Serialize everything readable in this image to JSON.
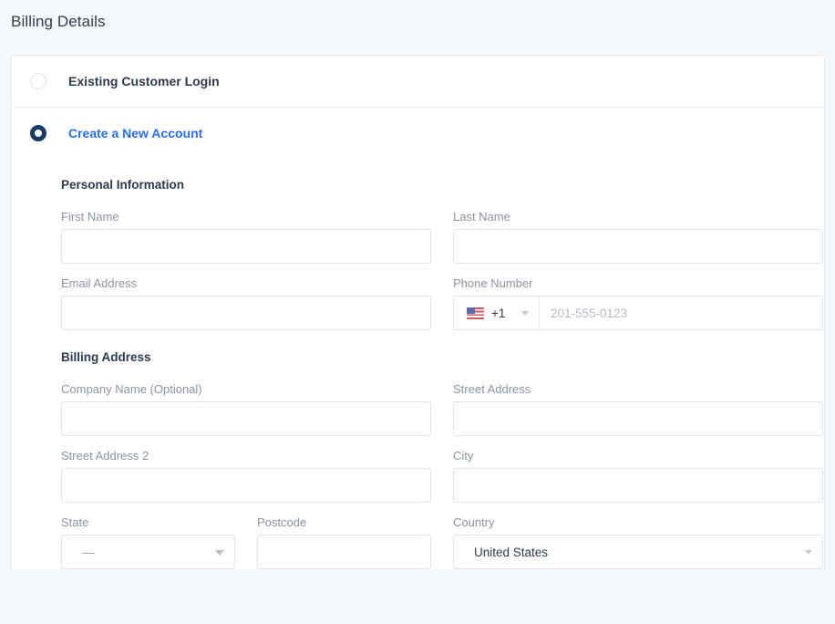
{
  "page": {
    "title": "Billing Details"
  },
  "account_options": [
    {
      "label": "Existing Customer Login",
      "selected": false,
      "name": "existing-customer-login"
    },
    {
      "label": "Create a New Account",
      "selected": true,
      "name": "create-new-account"
    }
  ],
  "sections": {
    "personal": {
      "title": "Personal Information",
      "first_name": {
        "label": "First Name",
        "value": "",
        "placeholder": ""
      },
      "last_name": {
        "label": "Last Name",
        "value": "",
        "placeholder": ""
      },
      "email": {
        "label": "Email Address",
        "value": "",
        "placeholder": ""
      },
      "phone": {
        "label": "Phone Number",
        "country_flag": "us-flag-icon",
        "dial_code": "+1",
        "value": "",
        "placeholder": "201-555-0123"
      }
    },
    "billing": {
      "title": "Billing Address",
      "company": {
        "label": "Company Name (Optional)",
        "value": "",
        "placeholder": ""
      },
      "street": {
        "label": "Street Address",
        "value": "",
        "placeholder": ""
      },
      "street2": {
        "label": "Street Address 2",
        "value": "",
        "placeholder": ""
      },
      "city": {
        "label": "City",
        "value": "",
        "placeholder": ""
      },
      "state": {
        "label": "State",
        "value": "—"
      },
      "postcode": {
        "label": "Postcode",
        "value": "",
        "placeholder": ""
      },
      "country": {
        "label": "Country",
        "value": "United States"
      }
    }
  },
  "icons": {
    "caret_down": "chevron-down-icon"
  },
  "colors": {
    "page_background": "#f4f8fb",
    "card_background": "#ffffff",
    "link_accent": "#2a6ee0",
    "radio_selected": "#1b3a66",
    "border": "#e2e4e8",
    "label_text": "#8b93a3",
    "heading_text": "#2e3b4e"
  }
}
